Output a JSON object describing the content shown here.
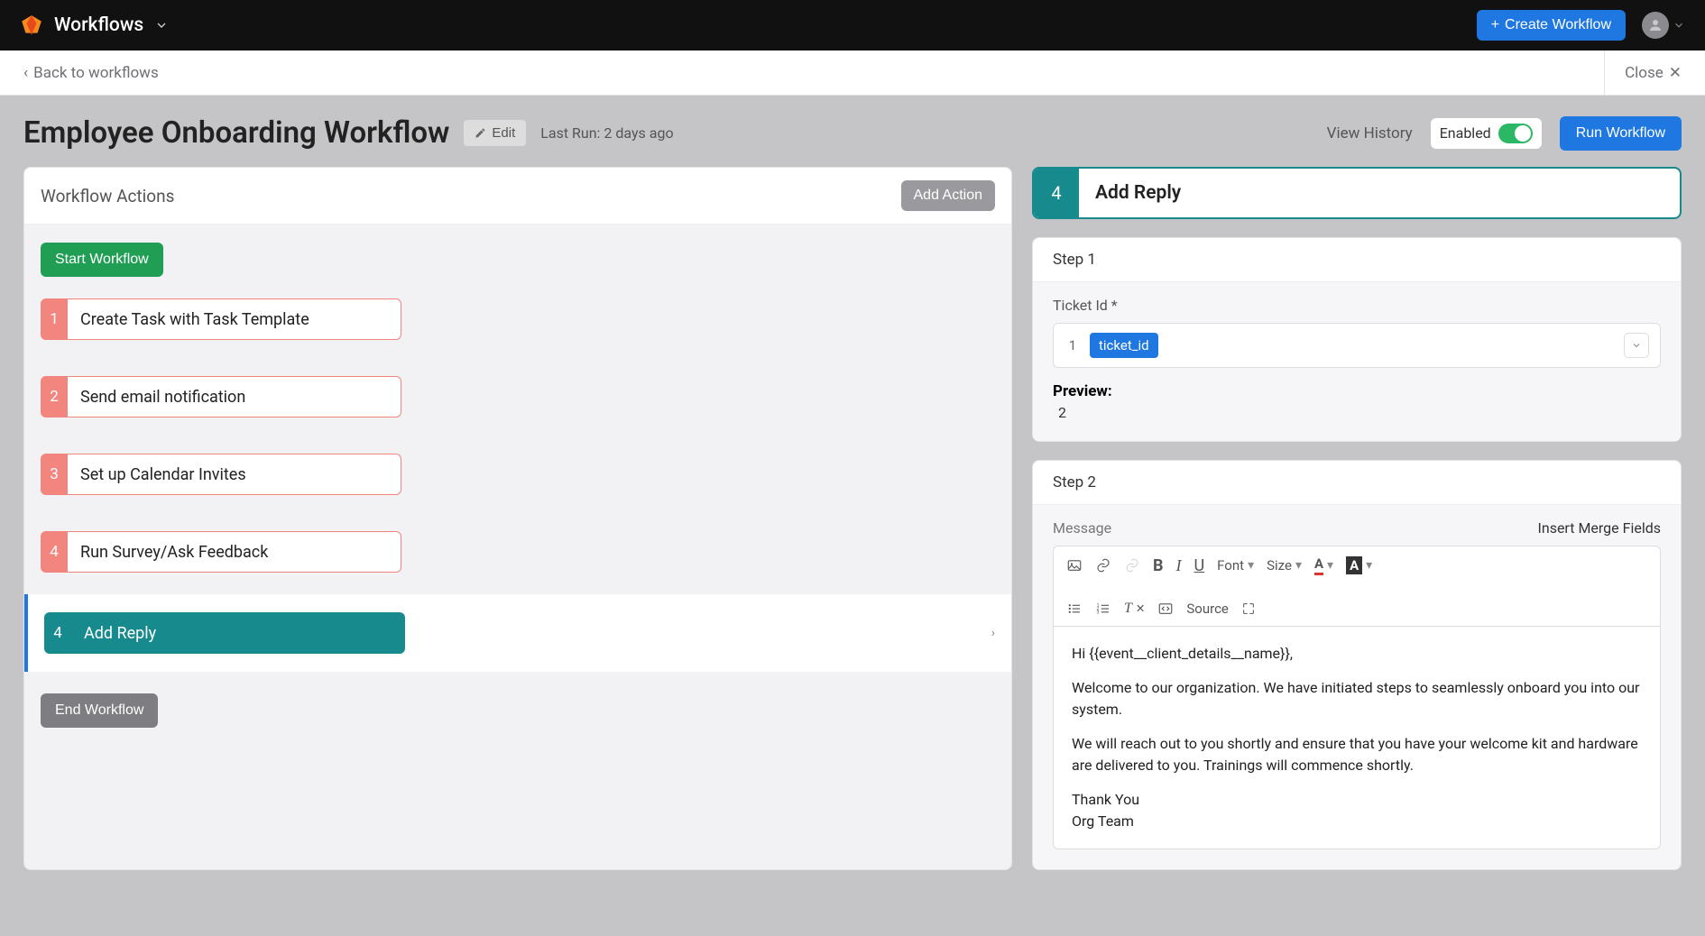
{
  "topbar": {
    "title": "Workflows",
    "create_label": "Create Workflow"
  },
  "subbar": {
    "back": "Back to workflows",
    "close": "Close"
  },
  "page": {
    "title": "Employee Onboarding Workflow",
    "edit": "Edit",
    "last_run": "Last Run: 2 days ago",
    "view_history": "View History",
    "enabled": "Enabled",
    "run": "Run Workflow"
  },
  "actions_panel": {
    "title": "Workflow Actions",
    "add_action": "Add Action",
    "start": "Start Workflow",
    "end": "End Workflow",
    "items": [
      {
        "n": "1",
        "label": "Create Task with Task Template"
      },
      {
        "n": "2",
        "label": "Send email notification"
      },
      {
        "n": "3",
        "label": "Set up Calendar Invites"
      },
      {
        "n": "4",
        "label": "Run Survey/Ask Feedback"
      }
    ],
    "selected": {
      "n": "4",
      "label": "Add Reply"
    }
  },
  "detail": {
    "n": "4",
    "title": "Add Reply",
    "step1": {
      "title": "Step 1",
      "ticket_label": "Ticket Id *",
      "ticket_idx": "1",
      "ticket_chip": "ticket_id",
      "preview_label": "Preview:",
      "preview_value": "2"
    },
    "step2": {
      "title": "Step 2",
      "message_label": "Message",
      "merge_label": "Insert Merge Fields",
      "toolbar": {
        "font": "Font",
        "size": "Size",
        "source": "Source"
      },
      "body_lines": [
        "Hi {{event__client_details__name}},",
        "Welcome to our organization. We have initiated steps to seamlessly onboard you into our system.",
        "We will reach out to you shortly and ensure that you have your welcome kit and hardware are delivered to you. Trainings will commence shortly.",
        "Thank You",
        "Org Team"
      ]
    }
  }
}
